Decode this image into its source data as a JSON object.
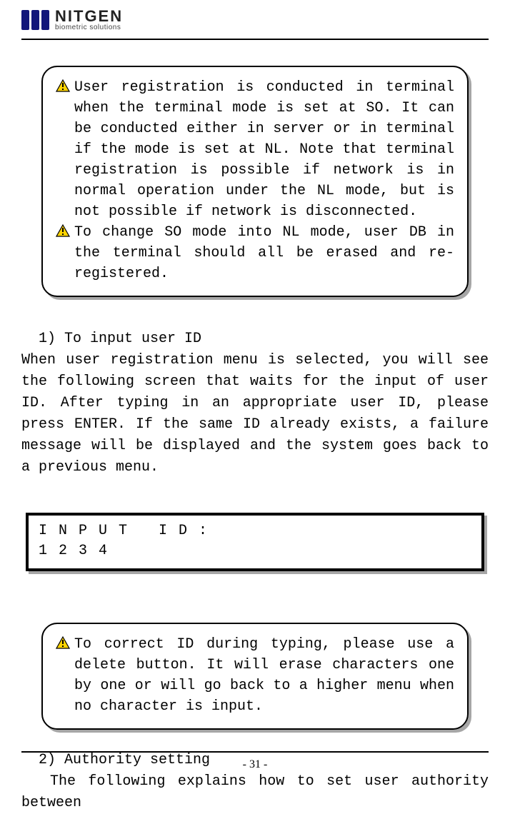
{
  "header": {
    "brand": "NITGEN",
    "tagline": "biometric solutions"
  },
  "warning1": {
    "item1": "User registration is conducted in terminal when the terminal mode is set at SO. It can be conducted either in server or in terminal if the mode is set at NL. Note that terminal registration is possible if network is in normal operation under the NL mode, but is not possible if network is disconnected.",
    "item2": "To change SO mode into NL mode, user DB in the terminal should all be erased and re-registered."
  },
  "section1": {
    "title": "1) To input user ID",
    "body": "When user registration menu is selected, you will see the following screen that waits for the input of user ID. After typing in an appropriate user ID, please press ENTER. If the same ID already exists, a failure message will be displayed and the system goes back to a previous menu."
  },
  "lcd": {
    "line1": "INPUT ID:",
    "line2": "1234"
  },
  "warning2": {
    "item1": "To correct ID during typing, please use a delete button. It will erase characters one by one or will go back to a higher menu when no character is input."
  },
  "section2": {
    "title": "2) Authority setting",
    "body": "The following explains how to set user authority between"
  },
  "footer": {
    "page": "- 31 -"
  }
}
